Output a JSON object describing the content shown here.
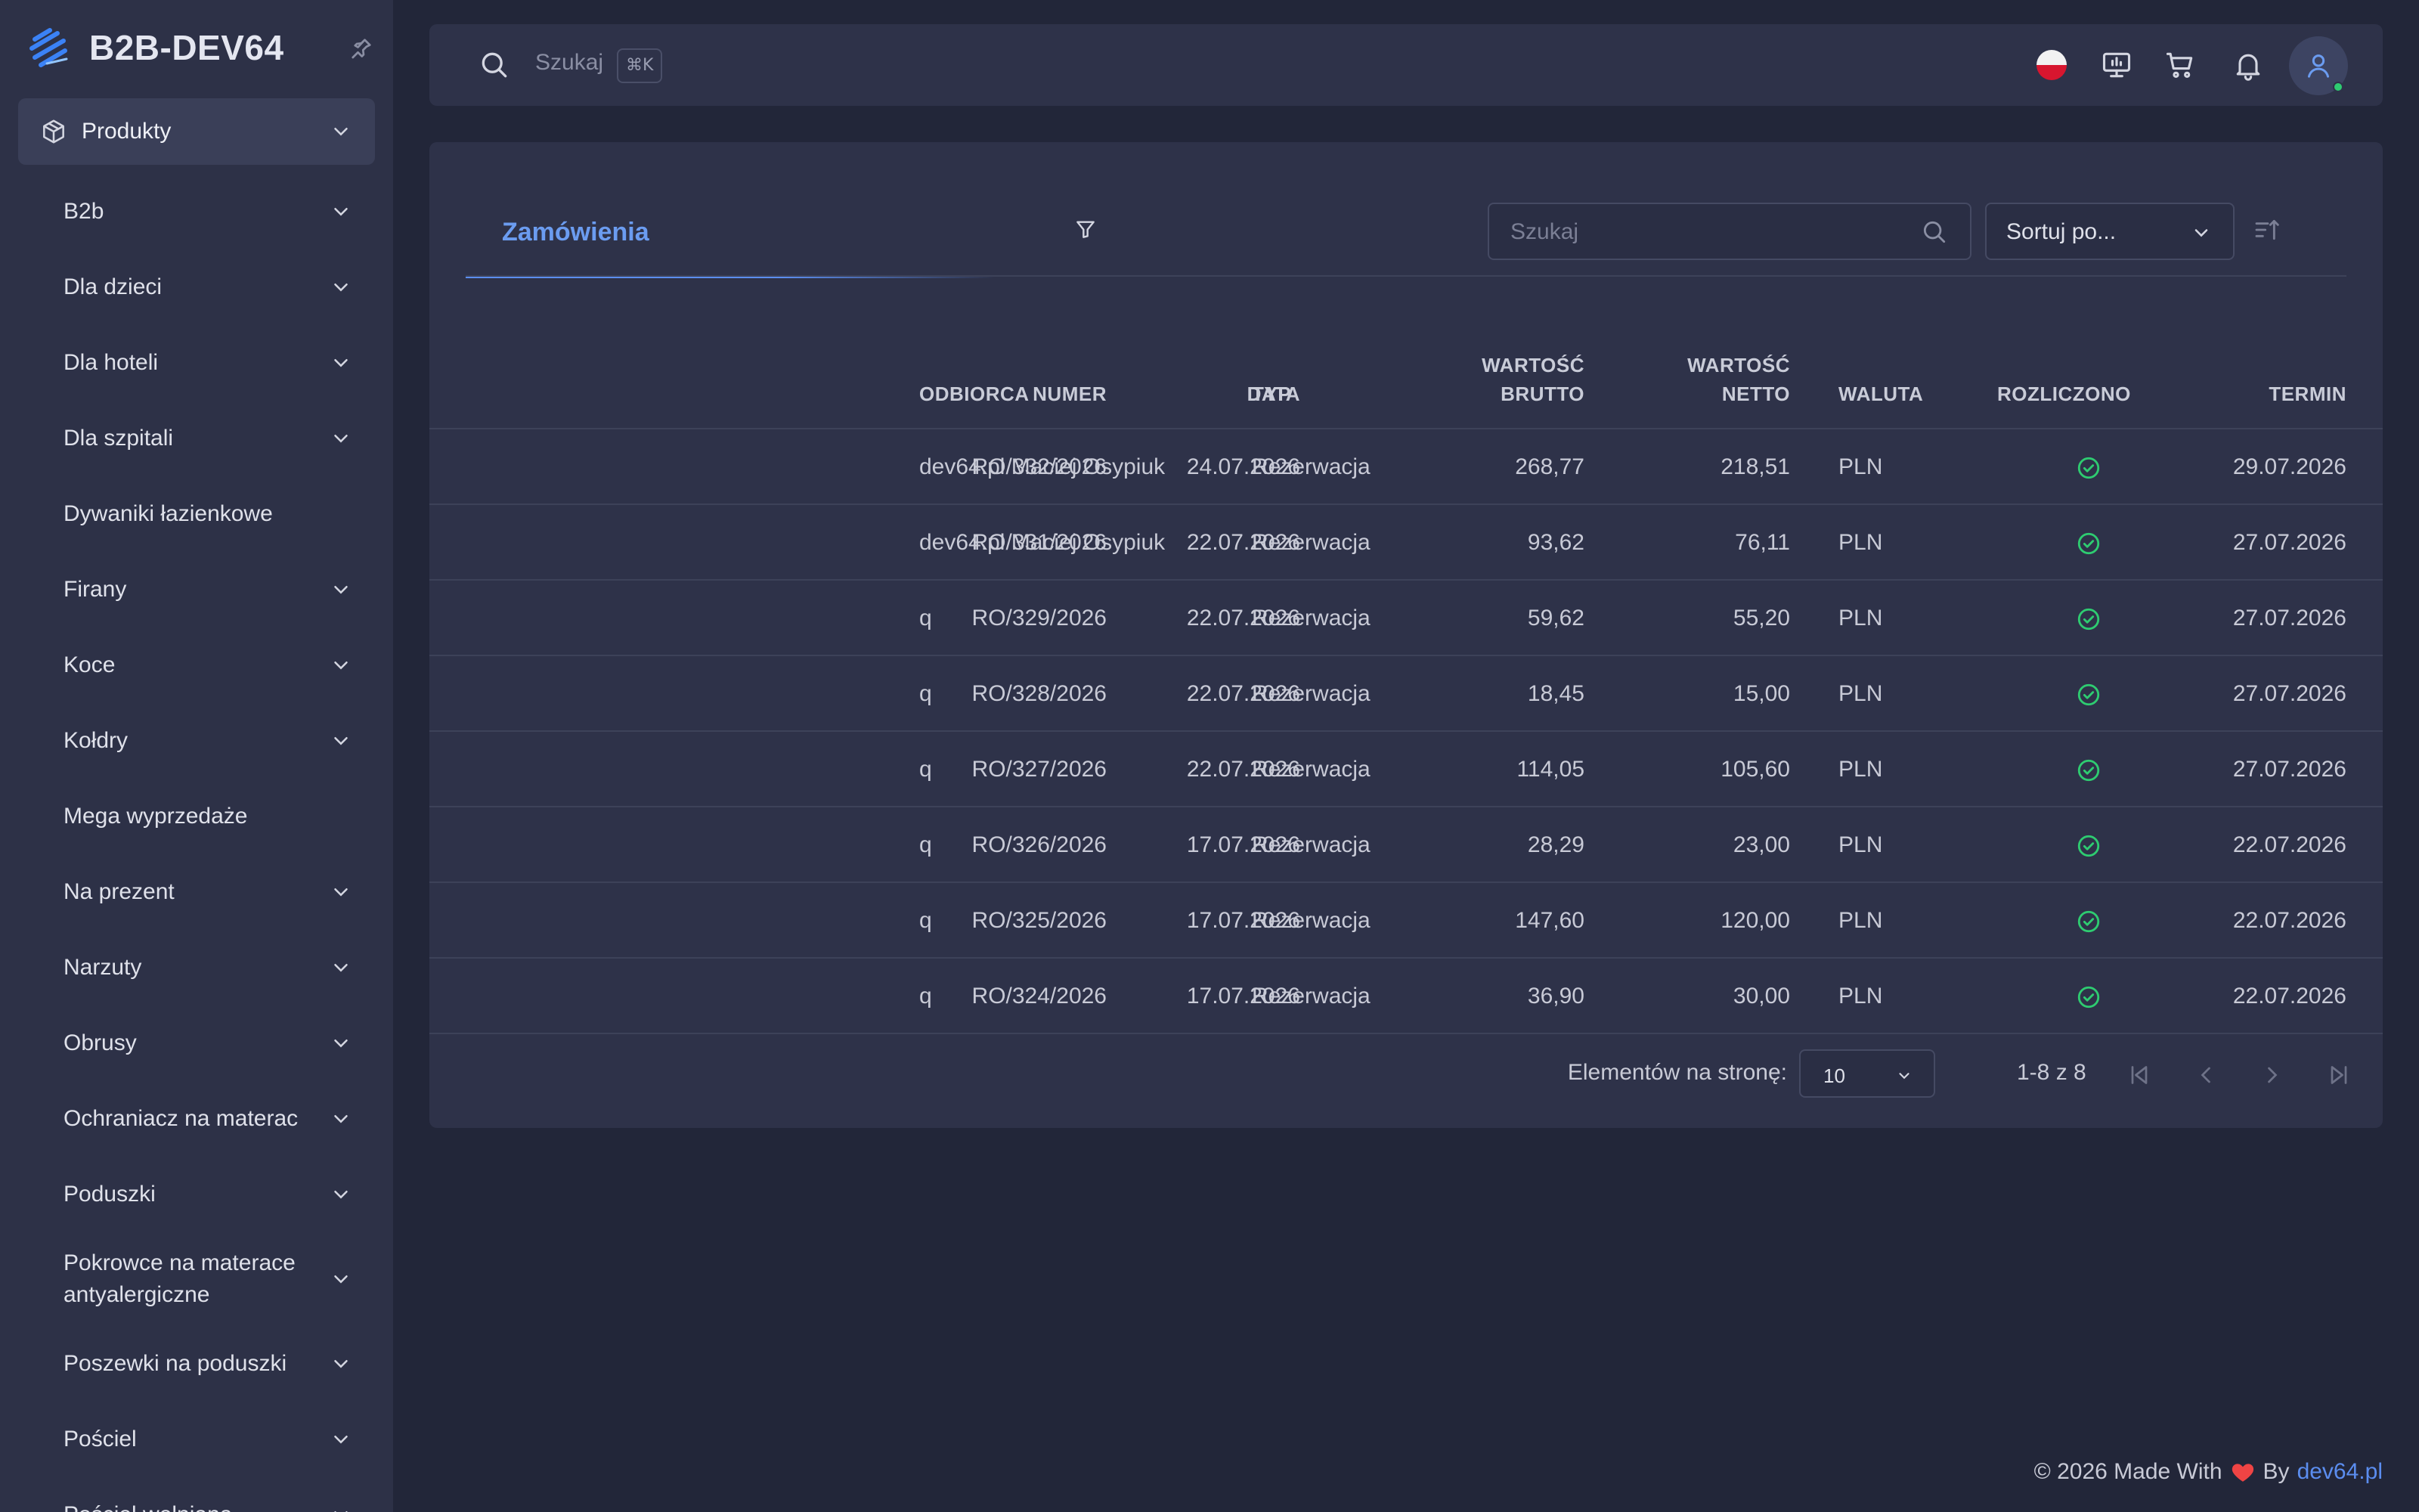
{
  "app": {
    "name": "B2B-DEV64"
  },
  "sidebar": {
    "active": {
      "label": "Produkty",
      "icon": "package-icon"
    },
    "items": [
      {
        "label": "B2b",
        "expandable": true
      },
      {
        "label": "Dla dzieci",
        "expandable": true
      },
      {
        "label": "Dla hoteli",
        "expandable": true
      },
      {
        "label": "Dla szpitali",
        "expandable": true
      },
      {
        "label": "Dywaniki łazienkowe",
        "expandable": false
      },
      {
        "label": "Firany",
        "expandable": true
      },
      {
        "label": "Koce",
        "expandable": true
      },
      {
        "label": "Kołdry",
        "expandable": true
      },
      {
        "label": "Mega wyprzedaże",
        "expandable": false
      },
      {
        "label": "Na prezent",
        "expandable": true
      },
      {
        "label": "Narzuty",
        "expandable": true
      },
      {
        "label": "Obrusy",
        "expandable": true
      },
      {
        "label": "Ochraniacz na materac",
        "expandable": true
      },
      {
        "label": "Poduszki",
        "expandable": true
      },
      {
        "label": "Pokrowce na materace antyalergiczne",
        "expandable": true
      },
      {
        "label": "Poszewki na poduszki",
        "expandable": true
      },
      {
        "label": "Pościel",
        "expandable": true
      },
      {
        "label": "Pościel wełniana",
        "expandable": true
      }
    ]
  },
  "topbar": {
    "search_placeholder": "Szukaj",
    "shortcut": "⌘K"
  },
  "orders": {
    "tab_label": "Zamówienia",
    "search_placeholder": "Szukaj",
    "sort_label": "Sortuj po...",
    "columns": {
      "numer": "NUMER",
      "data": "DATA",
      "odbiorca": "ODBIORCA",
      "typ": "TYP",
      "brutto_1": "WARTOŚĆ",
      "brutto_2": "BRUTTO",
      "netto_1": "WARTOŚĆ",
      "netto_2": "NETTO",
      "waluta": "WALUTA",
      "rozliczono": "ROZLICZONO",
      "termin": "TERMIN"
    },
    "rows": [
      {
        "numer": "RO/332/2026",
        "data": "24.07.2026",
        "odbiorca": "dev64.pl Maciej Osypiuk",
        "typ": "Rezerwacja",
        "brutto": "268,77",
        "netto": "218,51",
        "waluta": "PLN",
        "rozliczono": true,
        "termin": "29.07.2026"
      },
      {
        "numer": "RO/331/2026",
        "data": "22.07.2026",
        "odbiorca": "dev64.pl Maciej Osypiuk",
        "typ": "Rezerwacja",
        "brutto": "93,62",
        "netto": "76,11",
        "waluta": "PLN",
        "rozliczono": true,
        "termin": "27.07.2026"
      },
      {
        "numer": "RO/329/2026",
        "data": "22.07.2026",
        "odbiorca": "q",
        "typ": "Rezerwacja",
        "brutto": "59,62",
        "netto": "55,20",
        "waluta": "PLN",
        "rozliczono": true,
        "termin": "27.07.2026"
      },
      {
        "numer": "RO/328/2026",
        "data": "22.07.2026",
        "odbiorca": "q",
        "typ": "Rezerwacja",
        "brutto": "18,45",
        "netto": "15,00",
        "waluta": "PLN",
        "rozliczono": true,
        "termin": "27.07.2026"
      },
      {
        "numer": "RO/327/2026",
        "data": "22.07.2026",
        "odbiorca": "q",
        "typ": "Rezerwacja",
        "brutto": "114,05",
        "netto": "105,60",
        "waluta": "PLN",
        "rozliczono": true,
        "termin": "27.07.2026"
      },
      {
        "numer": "RO/326/2026",
        "data": "17.07.2026",
        "odbiorca": "q",
        "typ": "Rezerwacja",
        "brutto": "28,29",
        "netto": "23,00",
        "waluta": "PLN",
        "rozliczono": true,
        "termin": "22.07.2026"
      },
      {
        "numer": "RO/325/2026",
        "data": "17.07.2026",
        "odbiorca": "q",
        "typ": "Rezerwacja",
        "brutto": "147,60",
        "netto": "120,00",
        "waluta": "PLN",
        "rozliczono": true,
        "termin": "22.07.2026"
      },
      {
        "numer": "RO/324/2026",
        "data": "17.07.2026",
        "odbiorca": "q",
        "typ": "Rezerwacja",
        "brutto": "36,90",
        "netto": "30,00",
        "waluta": "PLN",
        "rozliczono": true,
        "termin": "22.07.2026"
      }
    ],
    "pagination": {
      "per_page_label": "Elementów na stronę:",
      "per_page_value": "10",
      "range": "1-8 z 8"
    }
  },
  "footer": {
    "text": "© 2026 Made With",
    "by": "By",
    "link": "dev64.pl"
  },
  "colors": {
    "accent": "#5b8def",
    "success": "#2ecc71",
    "background": "#222639",
    "sidebar": "#2d3147",
    "card": "#2e3249"
  }
}
